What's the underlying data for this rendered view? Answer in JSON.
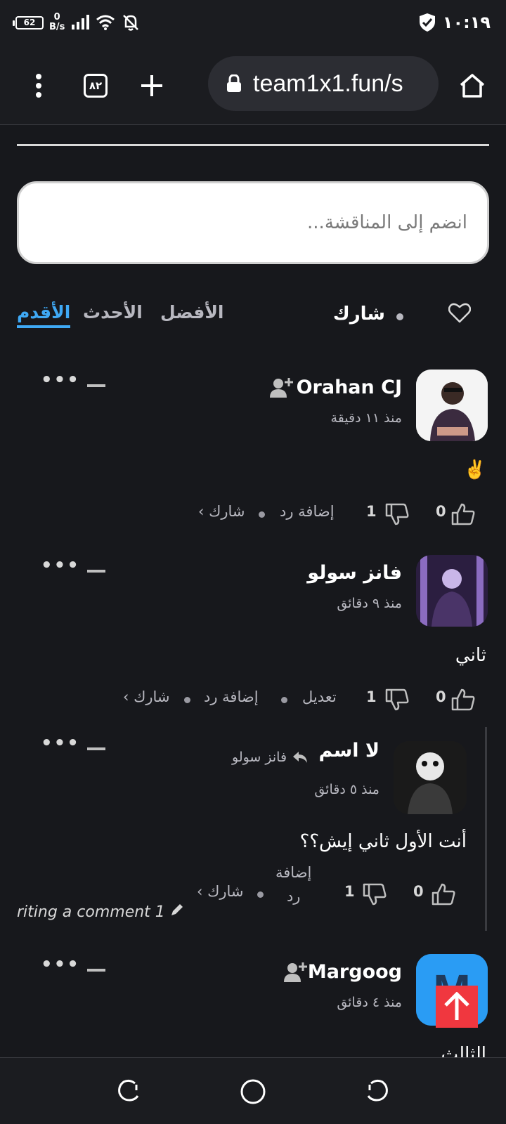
{
  "status_bar": {
    "battery": "62",
    "net_speed_value": "0",
    "net_speed_unit": "B/s",
    "time": "١٠:١٩"
  },
  "browser": {
    "tab_count": "٨٢",
    "url": "team1x1.fun/s"
  },
  "discussion": {
    "join_placeholder": "انضم إلى المناقشة...",
    "share_label": "شارك",
    "sort_tabs": [
      {
        "label": "الأقدم",
        "active": true
      },
      {
        "label": "الأحدث",
        "active": false
      },
      {
        "label": "الأفضل",
        "active": false
      }
    ]
  },
  "comments": [
    {
      "author": "Orahan CJ",
      "time": "منذ ١١ دقيقة",
      "body": "✌️",
      "likes": "0",
      "dislikes": "1",
      "reply": "إضافة رد",
      "share": "شارك ›"
    },
    {
      "author": "فانز سولو",
      "time": "منذ ٩ دقائق",
      "body": "ثاني",
      "likes": "0",
      "dislikes": "1",
      "edit": "تعديل",
      "reply": "إضافة رد",
      "share": "شارك ›"
    },
    {
      "author": "لا اسم",
      "reply_to": "فانز سولو",
      "time": "منذ ٥ دقائق",
      "body": "أنت الأول ثاني إيش؟؟",
      "likes": "0",
      "dislikes": "1",
      "reply_line1": "إضافة",
      "reply_line2": "رد",
      "share": "شارك ›"
    },
    {
      "author": "Margoog",
      "time": "منذ ٤ دقائق",
      "body": "الثالث"
    }
  ],
  "writing_indicator": "riting a comment 1",
  "colors": {
    "background": "#17181c",
    "accent": "#3fa9f5",
    "scroll_button": "#f0373f"
  },
  "icons": [
    "battery-icon",
    "signal-icon",
    "wifi-icon",
    "mute-icon",
    "shield-icon",
    "menu-icon",
    "plus-icon",
    "lock-icon",
    "home-icon",
    "heart-icon",
    "follow-icon",
    "like-icon",
    "dislike-icon",
    "reply-arrow-icon",
    "pencil-icon",
    "arrow-up-icon"
  ]
}
